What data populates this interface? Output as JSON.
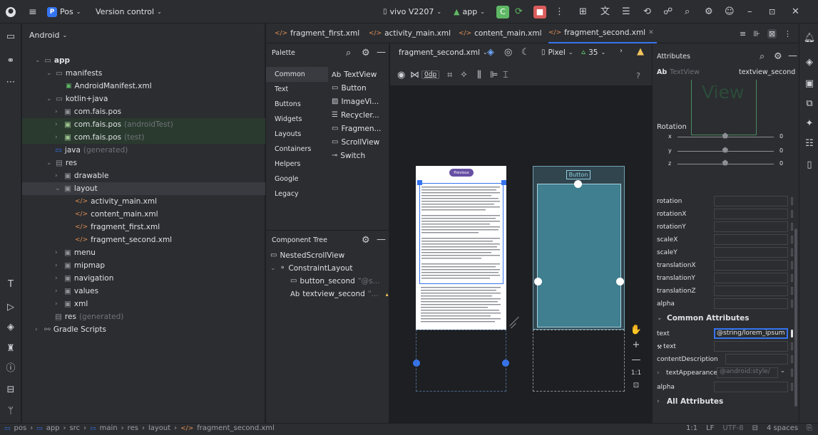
{
  "titlebar": {
    "project_badge": "P",
    "project": "Pos",
    "vcs": "Version control",
    "device": "vivo V2207",
    "run_config": "app"
  },
  "project_panel": {
    "header": "Android",
    "rows": [
      {
        "label": "app",
        "suffix": ""
      },
      {
        "label": "manifests",
        "suffix": ""
      },
      {
        "label": "AndroidManifest.xml",
        "suffix": ""
      },
      {
        "label": "kotlin+java",
        "suffix": ""
      },
      {
        "label": "com.fais.pos",
        "suffix": ""
      },
      {
        "label": "com.fais.pos",
        "suffix": "(androidTest)"
      },
      {
        "label": "com.fais.pos",
        "suffix": "(test)"
      },
      {
        "label": "java",
        "suffix": "(generated)"
      },
      {
        "label": "res",
        "suffix": ""
      },
      {
        "label": "drawable",
        "suffix": ""
      },
      {
        "label": "layout",
        "suffix": ""
      },
      {
        "label": "activity_main.xml",
        "suffix": ""
      },
      {
        "label": "content_main.xml",
        "suffix": ""
      },
      {
        "label": "fragment_first.xml",
        "suffix": ""
      },
      {
        "label": "fragment_second.xml",
        "suffix": ""
      },
      {
        "label": "menu",
        "suffix": ""
      },
      {
        "label": "mipmap",
        "suffix": ""
      },
      {
        "label": "navigation",
        "suffix": ""
      },
      {
        "label": "values",
        "suffix": ""
      },
      {
        "label": "xml",
        "suffix": ""
      },
      {
        "label": "res",
        "suffix": "(generated)"
      },
      {
        "label": "Gradle Scripts",
        "suffix": ""
      }
    ]
  },
  "tabs": [
    "fragment_first.xml",
    "activity_main.xml",
    "content_main.xml",
    "fragment_second.xml"
  ],
  "palette": {
    "title": "Palette",
    "categories": [
      "Common",
      "Text",
      "Buttons",
      "Widgets",
      "Layouts",
      "Containers",
      "Helpers",
      "Google",
      "Legacy"
    ],
    "items": [
      "TextView",
      "Button",
      "ImageVi...",
      "Recycler...",
      "Fragmen...",
      "ScrollView",
      "Switch"
    ],
    "textview_prefix": "Ab"
  },
  "component_tree": {
    "title": "Component Tree",
    "rows": [
      {
        "label": "NestedScrollView",
        "suffix": ""
      },
      {
        "label": "ConstraintLayout",
        "suffix": ""
      },
      {
        "label": "button_second",
        "suffix": "\"@s..."
      },
      {
        "label": "textview_second",
        "suffix": "\"..."
      }
    ]
  },
  "design_toolbar": {
    "file": "fragment_second.xml",
    "device": "Pixel",
    "api": "35",
    "margin": "0dp",
    "help": "?"
  },
  "canvas": {
    "preview_button": "Previous",
    "blueprint_button": "Button"
  },
  "attributes": {
    "title": "Attributes",
    "view_type": "TextView",
    "view_type_prefix": "Ab",
    "view_id": "textview_second",
    "preview_text": "View",
    "rotation_title": "Rotation",
    "sliders": [
      {
        "axis": "x",
        "value": "0",
        "level": 0.5
      },
      {
        "axis": "y",
        "value": "0",
        "level": 0.5
      },
      {
        "axis": "z",
        "value": "0",
        "level": 0.5
      }
    ],
    "transform_rows": [
      "rotation",
      "rotationX",
      "rotationY",
      "scaleX",
      "scaleY",
      "translationX",
      "translationY",
      "translationZ",
      "alpha"
    ],
    "common_title": "Common Attributes",
    "text_label": "text",
    "text_value": "@string/lorem_ipsum",
    "tools_text_label": "text",
    "content_description": "contentDescription",
    "text_appearance": "textAppearance",
    "text_appearance_value": "@android:style/",
    "alpha2": "alpha",
    "all_title": "All Attributes"
  },
  "statusbar": {
    "crumbs": [
      "pos",
      "app",
      "src",
      "main",
      "res",
      "layout",
      "fragment_second.xml"
    ],
    "position": "1:1",
    "line_sep": "LF",
    "encoding": "UTF-8",
    "indent": "4 spaces"
  },
  "colors": {
    "accent": "#3574f0",
    "panel": "#2b2d30",
    "blueprint": "#3f7f8f",
    "stop": "#db5c5c",
    "run": "#5fb865"
  }
}
